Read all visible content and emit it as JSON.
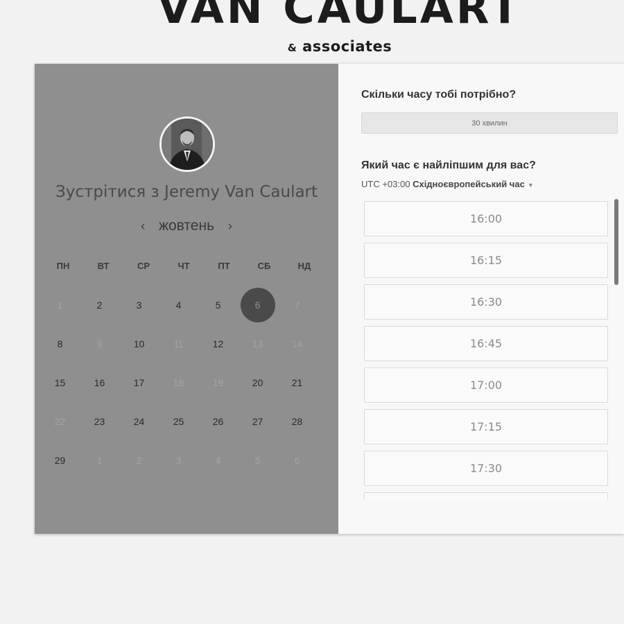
{
  "brand": {
    "title": "VAN CAULART",
    "ampersand": "&",
    "subtitle": "associates"
  },
  "host": {
    "heading_prefix": "Зустрітися з",
    "name": "Jeremy Van Caulart"
  },
  "calendar": {
    "month": "жовтень",
    "prev_icon": "chevron-left-icon",
    "next_icon": "chevron-right-icon",
    "prev_glyph": "‹",
    "next_glyph": "›",
    "weekdays": [
      "ПН",
      "ВТ",
      "СР",
      "ЧТ",
      "ПТ",
      "СБ",
      "НД"
    ],
    "selected_day": "6",
    "weeks": [
      [
        {
          "d": "1",
          "m": true
        },
        {
          "d": "2"
        },
        {
          "d": "3"
        },
        {
          "d": "4"
        },
        {
          "d": "5"
        },
        {
          "d": "6",
          "sel": true
        },
        {
          "d": "7",
          "m": true
        }
      ],
      [
        {
          "d": "8"
        },
        {
          "d": "9",
          "m": true
        },
        {
          "d": "10"
        },
        {
          "d": "11",
          "m": true
        },
        {
          "d": "12"
        },
        {
          "d": "13",
          "m": true
        },
        {
          "d": "14",
          "m": true
        }
      ],
      [
        {
          "d": "15"
        },
        {
          "d": "16"
        },
        {
          "d": "17"
        },
        {
          "d": "18",
          "m": true
        },
        {
          "d": "19",
          "m": true
        },
        {
          "d": "20"
        },
        {
          "d": "21"
        }
      ],
      [
        {
          "d": "22",
          "m": true
        },
        {
          "d": "23"
        },
        {
          "d": "24"
        },
        {
          "d": "25"
        },
        {
          "d": "26"
        },
        {
          "d": "27"
        },
        {
          "d": "28"
        }
      ],
      [
        {
          "d": "29"
        },
        {
          "d": "1",
          "m": true
        },
        {
          "d": "2",
          "m": true
        },
        {
          "d": "3",
          "m": true
        },
        {
          "d": "4",
          "m": true
        },
        {
          "d": "5",
          "m": true
        },
        {
          "d": "6",
          "m": true
        }
      ]
    ]
  },
  "duration": {
    "question": "Скільки часу тобі потрібно?",
    "value": "30 хвилин"
  },
  "time": {
    "question": "Який час є найліпшим для вас?",
    "tz_offset": "UTC +03:00",
    "tz_name": "Східноєвропейський час",
    "tz_caret": "▼",
    "slots": [
      "16:00",
      "16:15",
      "16:30",
      "16:45",
      "17:00",
      "17:15",
      "17:30",
      ""
    ]
  },
  "colors": {
    "left_pane": "#8f8f8f",
    "selected_day": "#4a4a4a",
    "page_bg": "#f2f2f2"
  }
}
